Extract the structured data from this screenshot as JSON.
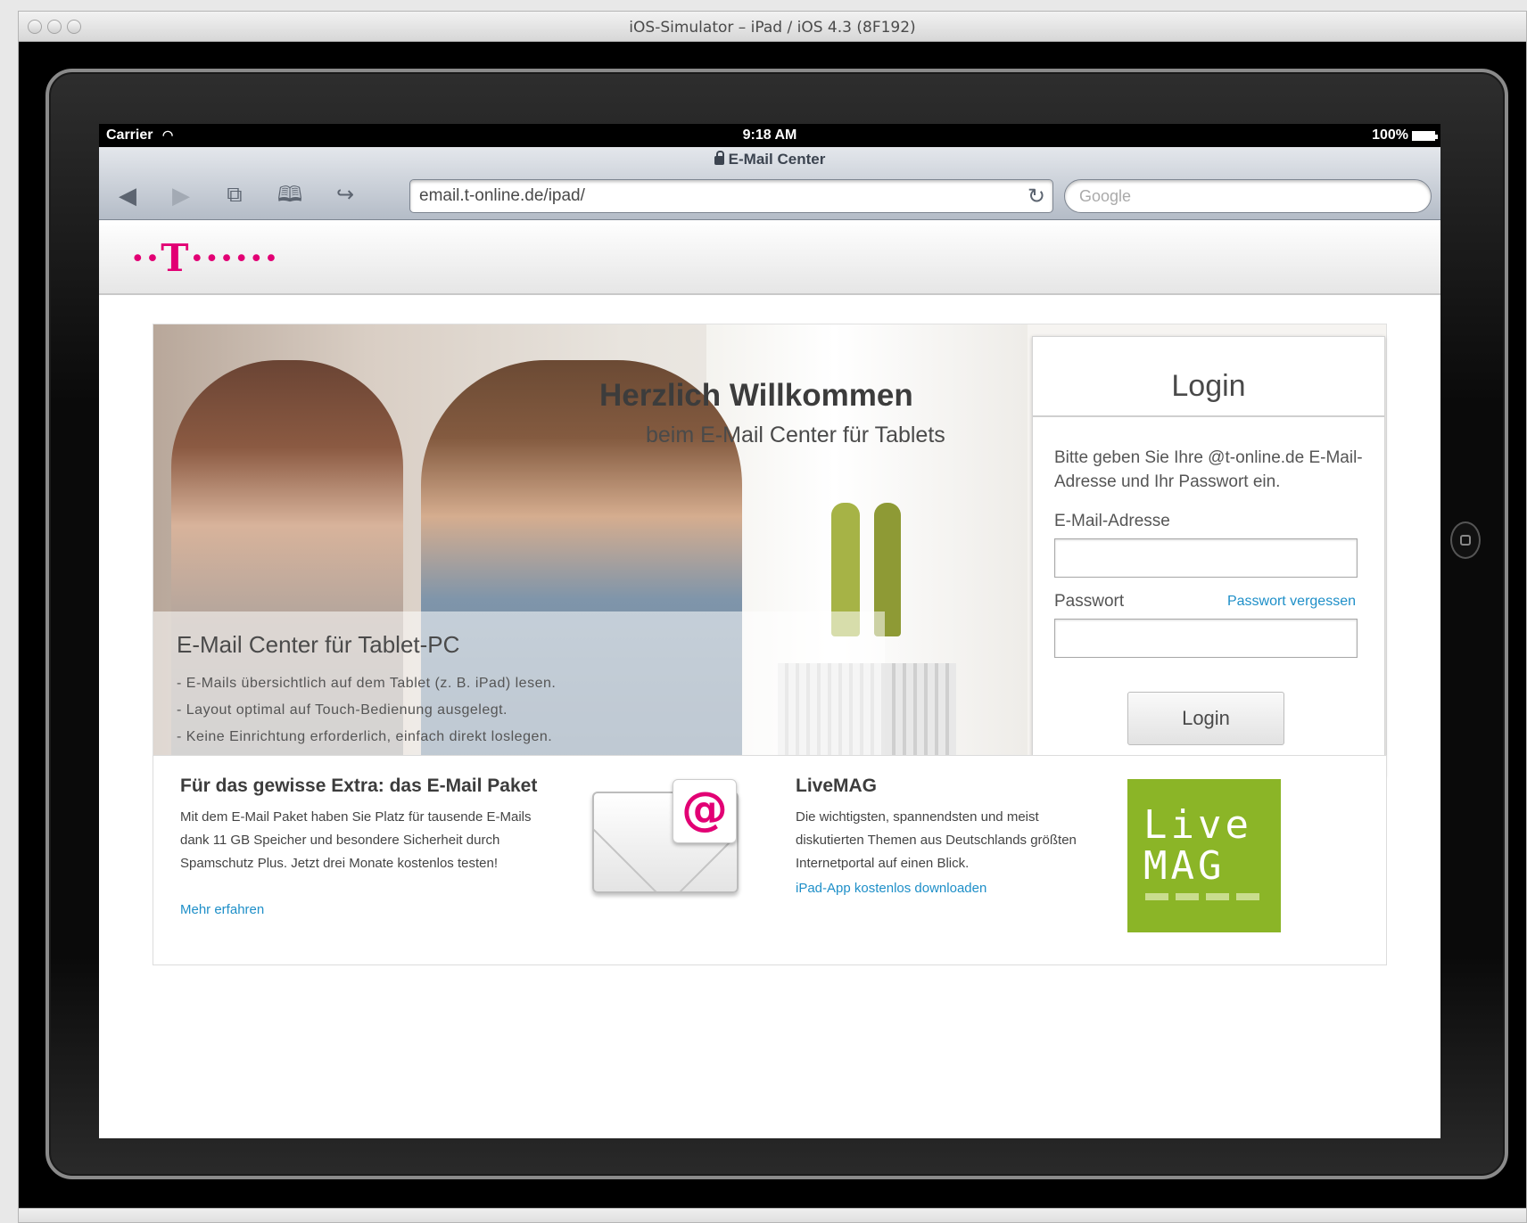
{
  "mac": {
    "title": "iOS-Simulator – iPad / iOS 4.3 (8F192)"
  },
  "status_bar": {
    "carrier": "Carrier",
    "time": "9:18 AM",
    "battery": "100%"
  },
  "safari": {
    "page_title": "E-Mail Center",
    "url": "email.t-online.de/ipad/",
    "search_placeholder": "Google",
    "icons": [
      "back-icon",
      "forward-icon",
      "tabs-icon",
      "bookmarks-icon",
      "share-icon",
      "reload-icon"
    ]
  },
  "telekom": {
    "logo_text": "··T······",
    "brand_color": "#e20074"
  },
  "hero": {
    "headline": "Herzlich Willkommen",
    "subline": "beim E-Mail Center für Tablets",
    "overlay_title": "E-Mail Center für Tablet-PC",
    "bullets": [
      "- E-Mails übersichtlich auf dem Tablet (z. B. iPad) lesen.",
      "- Layout optimal auf Touch-Bedienung ausgelegt.",
      "- Keine Einrichtung erforderlich, einfach direkt loslegen."
    ]
  },
  "login": {
    "title": "Login",
    "description": "Bitte geben Sie Ihre @t-online.de E-Mail-Adresse und Ihr Passwort ein.",
    "email_label": "E-Mail-Adresse",
    "password_label": "Passwort",
    "forgot_link": "Passwort vergessen",
    "email_value": "",
    "password_value": "",
    "button_label": "Login"
  },
  "promo": {
    "paket_title": "Für das gewisse Extra: das E-Mail Paket",
    "paket_text": "Mit dem E-Mail Paket haben Sie Platz für tausende E-Mails dank 11 GB Speicher und besondere Sicherheit durch Spamschutz Plus. Jetzt drei Monate kostenlos testen!",
    "paket_link": "Mehr erfahren",
    "envelope_symbol": "@",
    "livemag_title": "LiveMAG",
    "livemag_text": "Die wichtigsten, spannendsten und meist diskutierten Themen aus Deutschlands größten Internetportal auf einen Blick.",
    "livemag_link": "iPad-App kostenlos downloaden",
    "livemag_logo_line1": "Live",
    "livemag_logo_line2": "MAG",
    "livemag_color": "#8bb527"
  }
}
